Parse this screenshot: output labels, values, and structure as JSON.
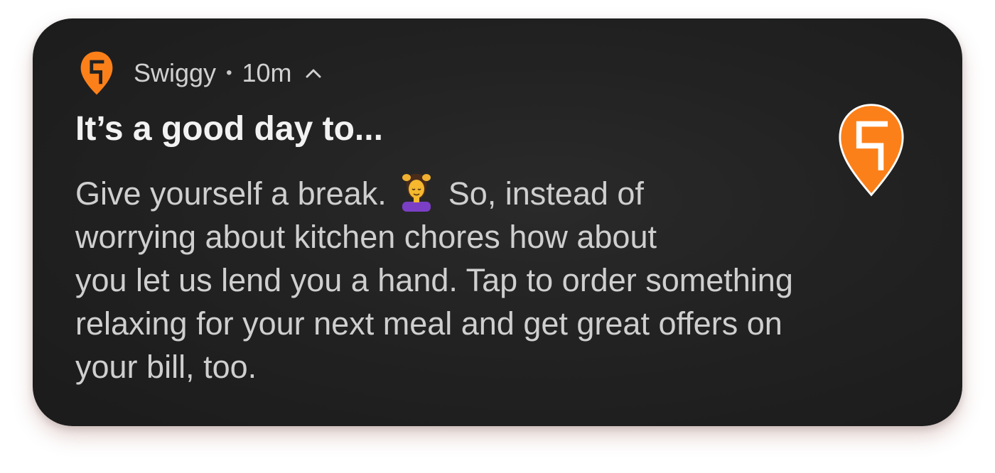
{
  "notification": {
    "app_icon": "swiggy-logo-icon",
    "app_name": "Swiggy",
    "separator": "•",
    "time": "10m",
    "expand_icon": "chevron-up-icon",
    "title": "It’s a good day to...",
    "body_lines": [
      {
        "before": "Give yourself a break.",
        "after": "So, instead of"
      },
      "worrying about kitchen chores how about",
      "you let us lend you a hand. Tap to order something",
      "relaxing for your next meal and get great offers on",
      "your bill, too."
    ],
    "emoji_icon": "person-getting-massage-emoji",
    "large_icon": "swiggy-logo-large-icon",
    "colors": {
      "card_background": "#222222",
      "brand_orange": "#fc8019",
      "title_text": "#f2f2f2",
      "body_text": "#cfcfcf"
    }
  }
}
